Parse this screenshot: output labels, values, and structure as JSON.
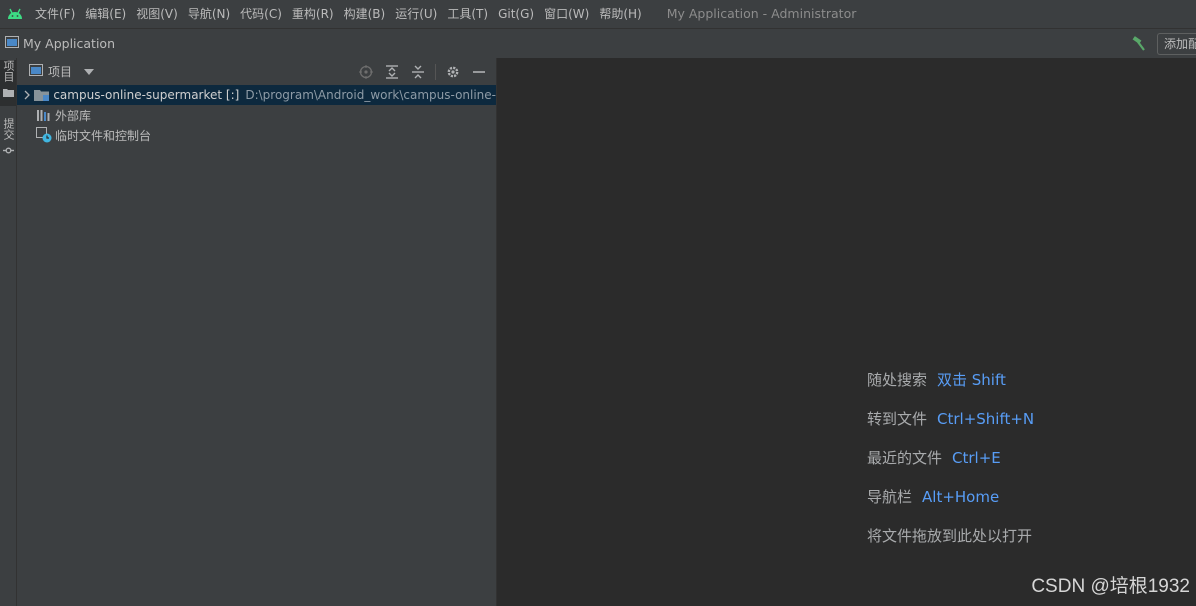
{
  "menu": {
    "items": [
      "文件(F)",
      "编辑(E)",
      "视图(V)",
      "导航(N)",
      "代码(C)",
      "重构(R)",
      "构建(B)",
      "运行(U)",
      "工具(T)",
      "Git(G)",
      "窗口(W)",
      "帮助(H)"
    ],
    "window_title": "My Application - Administrator"
  },
  "navbar": {
    "project_name": "My Application",
    "add_config_label": "添加配置"
  },
  "stripe": {
    "project_tab": "项目",
    "commit_tab": "提交"
  },
  "panel": {
    "title": "项目",
    "tree": {
      "root_label": "campus-online-supermarket [:]",
      "root_path": "D:\\program\\Android_work\\campus-online-",
      "external_libs": "外部库",
      "scratches": "临时文件和控制台"
    }
  },
  "editor": {
    "hints": [
      {
        "label": "随处搜索",
        "key": "双击 Shift"
      },
      {
        "label": "转到文件",
        "key": "Ctrl+Shift+N"
      },
      {
        "label": "最近的文件",
        "key": "Ctrl+E"
      },
      {
        "label": "导航栏",
        "key": "Alt+Home"
      },
      {
        "label": "将文件拖放到此处以打开",
        "key": ""
      }
    ]
  },
  "watermark": "CSDN @培根1932",
  "colors": {
    "background": "#2b2b2b",
    "panel": "#3c3f41",
    "selection": "#0d293e",
    "shortcut": "#589df6",
    "android_green": "#3ddc84"
  }
}
